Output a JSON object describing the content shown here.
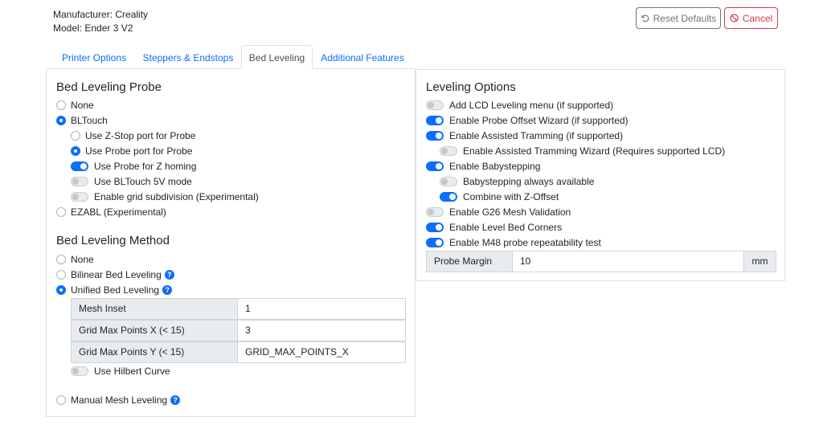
{
  "header": {
    "manufacturer": "Manufacturer: Creality",
    "model": "Model: Ender 3 V2",
    "reset_label": "Reset Defaults",
    "cancel_label": "Cancel"
  },
  "tabs": [
    {
      "label": "Printer Options",
      "active": false
    },
    {
      "label": "Steppers & Endstops",
      "active": false
    },
    {
      "label": "Bed Leveling",
      "active": true
    },
    {
      "label": "Additional Features",
      "active": false
    }
  ],
  "probe": {
    "title": "Bed Leveling Probe",
    "none": "None",
    "bltouch": "BLTouch",
    "zstop_port": "Use Z-Stop port for Probe",
    "probe_port": "Use Probe port for Probe",
    "z_homing": "Use Probe for Z homing",
    "bltouch_5v": "Use BLTouch 5V mode",
    "grid_subdivision": "Enable grid subdivision (Experimental)",
    "ezabl": "EZABL (Experimental)"
  },
  "method": {
    "title": "Bed Leveling Method",
    "none": "None",
    "bilinear": "Bilinear Bed Leveling",
    "unified": "Unified Bed Leveling",
    "mesh_inset_label": "Mesh Inset",
    "mesh_inset_value": "1",
    "grid_x_label": "Grid Max Points X (< 15)",
    "grid_x_value": "3",
    "grid_y_label": "Grid Max Points Y (< 15)",
    "grid_y_value": "GRID_MAX_POINTS_X",
    "hilbert": "Use Hilbert Curve",
    "manual": "Manual Mesh Leveling"
  },
  "options": {
    "title": "Leveling Options",
    "lcd_menu": "Add LCD Leveling menu (if supported)",
    "probe_offset_wizard": "Enable Probe Offset Wizard (if supported)",
    "assisted_tramming": "Enable Assisted Tramming (if supported)",
    "tramming_wizard": "Enable Assisted Tramming Wizard (Requires supported LCD)",
    "babystepping": "Enable Babystepping",
    "babystep_always": "Babystepping always available",
    "combine_zoffset": "Combine with Z-Offset",
    "g26": "Enable G26 Mesh Validation",
    "level_corners": "Enable Level Bed Corners",
    "m48": "Enable M48 probe repeatability test",
    "probe_margin_label": "Probe Margin",
    "probe_margin_value": "10",
    "probe_margin_unit": "mm"
  },
  "help_glyph": "?",
  "accent": "#0d6efd"
}
